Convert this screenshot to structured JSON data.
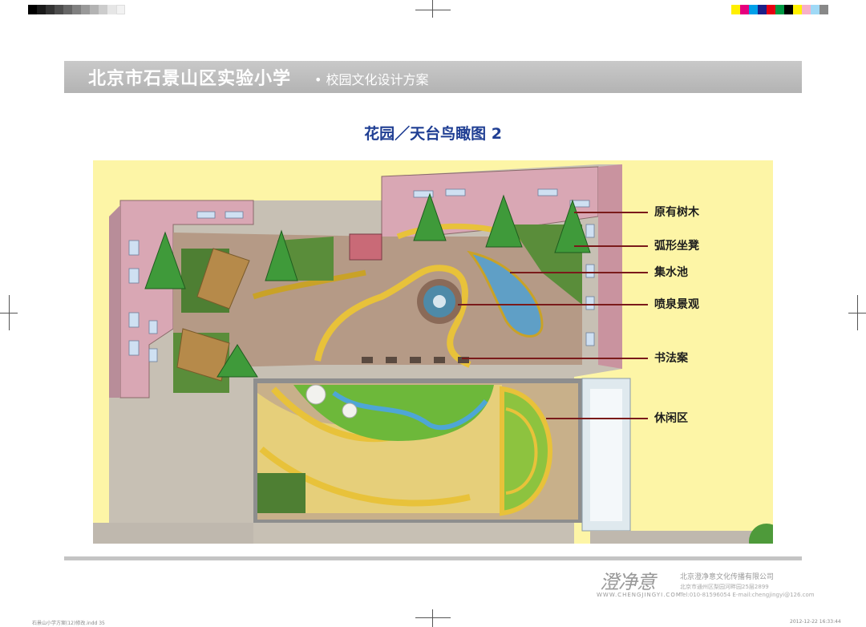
{
  "header": {
    "school_name": "北京市石景山区实验小学",
    "plan_title": "• 校园文化设计方案"
  },
  "section_title": "花园／天台鸟瞰图 2",
  "callouts": [
    {
      "label": "原有树木"
    },
    {
      "label": "弧形坐凳"
    },
    {
      "label": "集水池"
    },
    {
      "label": "喷泉景观"
    },
    {
      "label": "书法案"
    },
    {
      "label": "休闲区"
    }
  ],
  "footer": {
    "logo_text": "澄净意",
    "logo_url": "WWW.CHENGJINGYI.COM",
    "company": "北京澄净意文化传播有限公司",
    "address": "北京市通州区梨园河畔园25层2899",
    "contact": "Tel:010-81596054   E-mail:chengjingyi@126.com",
    "file_slug": "石景山小学方案(12)修改.indd  35",
    "print_date": "2012-12-22  16:33:44"
  },
  "colors": {
    "title_blue": "#1f3e93",
    "leader_red": "#7a1a1a",
    "canvas_yellow": "#fdf5a6",
    "building_pink": "#d9a7b4",
    "paving": "#b59a86",
    "lawn": "#6db83a"
  }
}
